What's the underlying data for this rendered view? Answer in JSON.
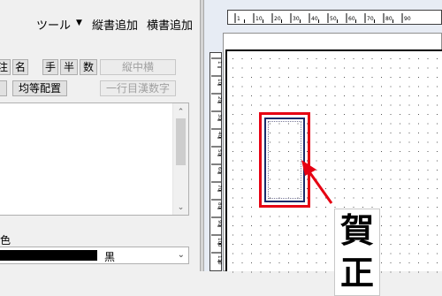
{
  "menu": {
    "tool_label": "ツール",
    "tool_arrow": "▼",
    "vertical_add_label": "縦書追加",
    "horizontal_add_label": "横書追加"
  },
  "toolbar": {
    "row1_partial": "注",
    "name_label": "名",
    "hand_label": "手",
    "half_label": "半",
    "number_label": "数",
    "tatechuyoko_label": "縦中横",
    "even_align_label": "均等配置",
    "one_line_kanji_label": "一行目漢数字"
  },
  "list": {
    "scroll_up": "⌃",
    "scroll_down": "⌄"
  },
  "color": {
    "label": "色",
    "selected": "黒",
    "swatch_color": "#000000",
    "dropdown_arrow": "⌄"
  },
  "ruler": {
    "h_labels": [
      "1",
      "10",
      "20",
      "30",
      "40",
      "50",
      "60",
      "70",
      "80",
      "90"
    ],
    "v_labels": [
      "1",
      "10",
      "20",
      "30",
      "40",
      "50",
      "60",
      "70",
      "80",
      "90",
      "100",
      "110"
    ]
  },
  "canvas": {
    "kanji_1": "賀",
    "kanji_2": "正",
    "highlight_color": "#e60012"
  }
}
